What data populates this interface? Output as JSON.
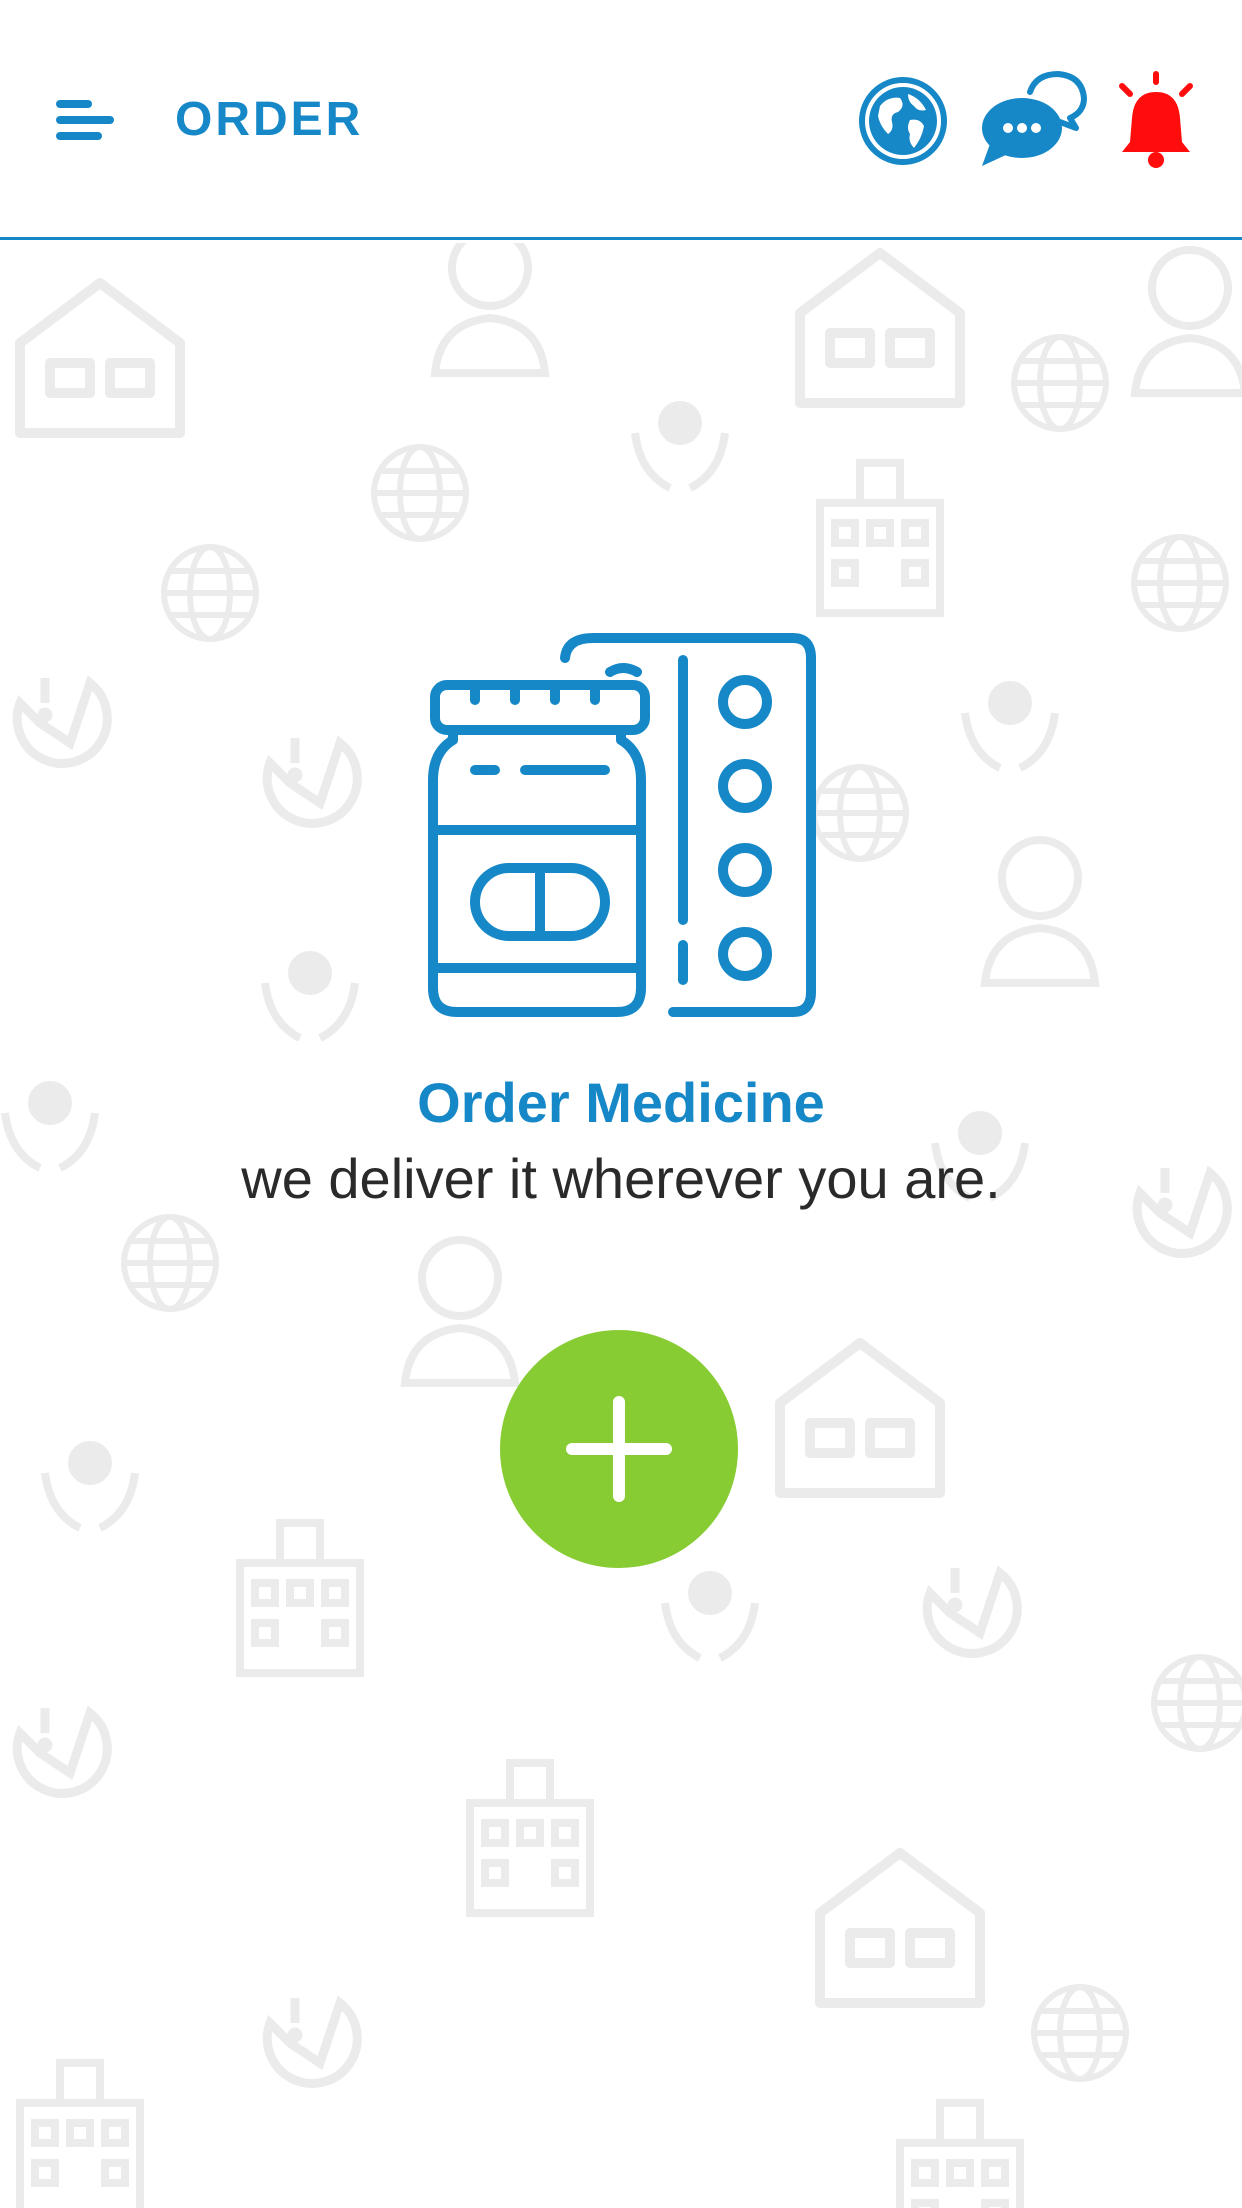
{
  "header": {
    "title": "ORDER",
    "icons": {
      "menu": "hamburger-menu-icon",
      "language": "globe-icon",
      "chat": "chat-bubbles-icon",
      "notifications": "bell-icon"
    }
  },
  "main": {
    "illustration": "medicine-bottle-and-pill-strip-icon",
    "title": "Order Medicine",
    "subtitle": "we deliver it wherever you are.",
    "add_button_icon": "plus-icon"
  },
  "colors": {
    "primary": "#1688c8",
    "accent_green": "#88cc34",
    "alert_red": "#ff0d0d",
    "pattern_gray": "#ebebeb",
    "text_dark": "#2a2a2a"
  }
}
